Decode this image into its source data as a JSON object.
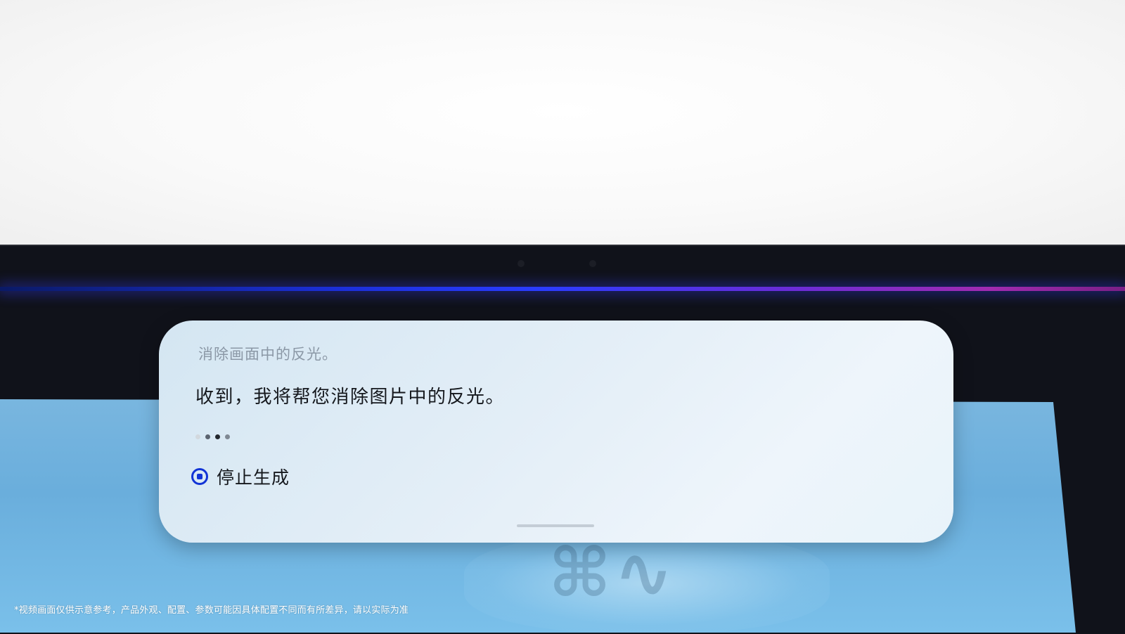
{
  "assistant_card": {
    "query_text": "消除画面中的反光。",
    "response_text": "收到，我将帮您消除图片中的反光。",
    "typing_dots_colors": [
      "#d2d8de",
      "#5b6470",
      "#23272d",
      "#7f8893"
    ],
    "stop_button_label": "停止生成",
    "stop_icon": "stop-circle-icon",
    "accent_color": "#1234d6"
  },
  "background": {
    "glow_colors": [
      "#1b2fd8",
      "#a12bb0"
    ],
    "screen_color": "#6aaedc"
  },
  "footer": {
    "disclaimer": "*视频画面仅供示意参考，产品外观、配置、参数可能因具体配置不同而有所差异，请以实际为准"
  }
}
